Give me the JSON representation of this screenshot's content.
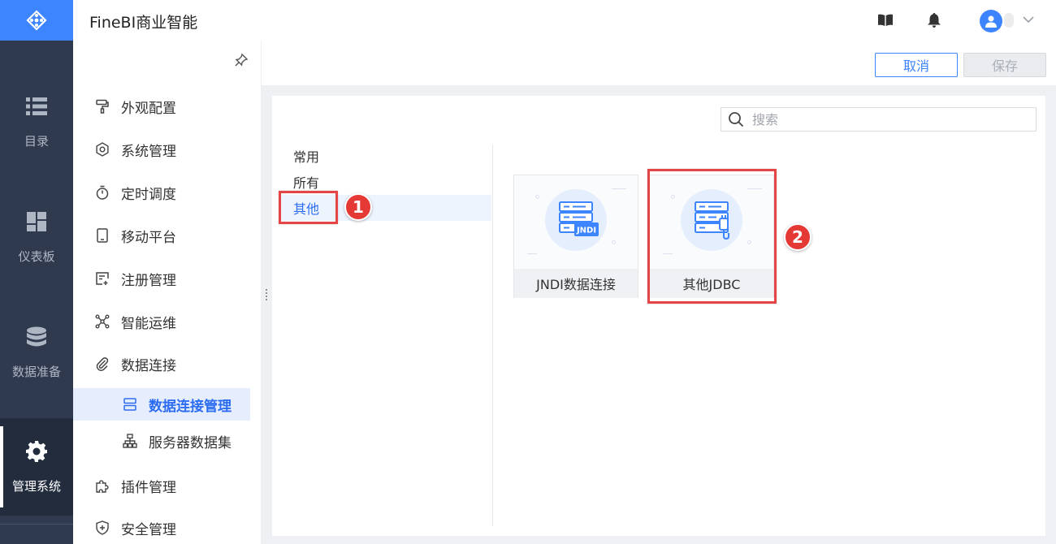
{
  "app": {
    "title": "FineBI商业智能"
  },
  "rail": {
    "items": [
      {
        "label": "目录",
        "icon": "list-icon"
      },
      {
        "label": "仪表板",
        "icon": "dashboard-icon"
      },
      {
        "label": "数据准备",
        "icon": "database-icon"
      },
      {
        "label": "管理系统",
        "icon": "gear-icon",
        "active": true
      }
    ]
  },
  "menu": {
    "items": [
      {
        "label": "外观配置",
        "icon": "paint-roller-icon"
      },
      {
        "label": "系统管理",
        "icon": "settings-icon"
      },
      {
        "label": "定时调度",
        "icon": "timer-icon"
      },
      {
        "label": "移动平台",
        "icon": "mobile-icon"
      },
      {
        "label": "注册管理",
        "icon": "register-icon"
      },
      {
        "label": "智能运维",
        "icon": "network-icon"
      },
      {
        "label": "数据连接",
        "icon": "paperclip-icon"
      },
      {
        "label": "数据连接管理",
        "icon": "server-icon",
        "sub": true,
        "selected": true
      },
      {
        "label": "服务器数据集",
        "icon": "hierarchy-icon",
        "sub": true
      },
      {
        "label": "插件管理",
        "icon": "puzzle-icon"
      },
      {
        "label": "安全管理",
        "icon": "shield-icon"
      }
    ]
  },
  "toolbar": {
    "cancel_label": "取消",
    "save_label": "保存"
  },
  "search": {
    "placeholder": "搜索"
  },
  "categories": [
    {
      "label": "常用"
    },
    {
      "label": "所有"
    },
    {
      "label": "其他",
      "active": true
    }
  ],
  "cards": [
    {
      "label": "JNDI数据连接",
      "tag": "JNDI"
    },
    {
      "label": "其他JDBC"
    }
  ],
  "annotations": [
    {
      "number": "1"
    },
    {
      "number": "2"
    }
  ],
  "colors": {
    "accent": "#3d84ff",
    "rail": "#2f3a4f",
    "highlight": "#e64545"
  }
}
